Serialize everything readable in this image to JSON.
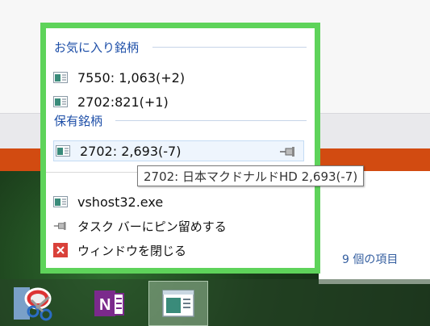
{
  "jumplist": {
    "favorites_header": "お気に入り銘柄",
    "favorites": [
      {
        "label": "7550: 1,063(+2)",
        "icon": "window-app-icon"
      },
      {
        "label": "2702:821(+1)",
        "icon": "window-app-icon"
      }
    ],
    "holdings_header": "保有銘柄",
    "holdings": [
      {
        "label": "2702: 2,693(-7)",
        "icon": "window-app-icon",
        "pin_icon": "pushpin-icon"
      }
    ],
    "tasks": [
      {
        "label": "vshost32.exe",
        "icon": "window-app-icon"
      },
      {
        "label": "タスク バーにピン留めする",
        "icon": "pushpin-icon"
      },
      {
        "label": "ウィンドウを閉じる",
        "icon": "close-x-icon"
      }
    ]
  },
  "tooltip": {
    "text": "2702: 日本マクドナルドHD 2,693(-7)"
  },
  "explorer": {
    "status_text": "9 個の項目"
  },
  "taskbar": {
    "buttons": [
      {
        "name": "snipping-tool",
        "icon": "scissors-icon"
      },
      {
        "name": "onenote",
        "icon": "onenote-icon"
      },
      {
        "name": "stock-app",
        "icon": "window-app-icon"
      }
    ]
  },
  "colors": {
    "jumplist_border": "#5ed35a",
    "header_text": "#1e4fa8",
    "accent_orange": "#d24b11"
  }
}
